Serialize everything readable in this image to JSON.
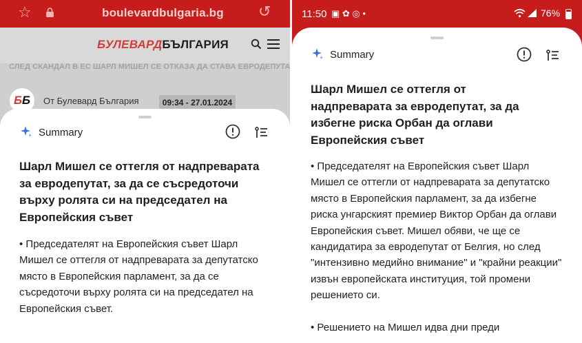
{
  "left": {
    "browser": {
      "url": "boulevardbulgaria.bg",
      "icons": [
        "star-icon",
        "lock-icon",
        "reload-icon"
      ]
    },
    "site": {
      "logo_part1": "БУЛЕВАРД",
      "logo_part2": "БЪЛГАРИЯ",
      "icons": [
        "search-icon",
        "menu-icon"
      ]
    },
    "article": {
      "headline": "СЛЕД СКАНДАЛ В ЕС ШАРЛ МИШЕЛ СЕ ОТКАЗА ДА СТАВА ЕВРОДЕПУТАТ",
      "badge_part1": "Б",
      "badge_part2": "Б",
      "author": "От Булевард България",
      "datetime": "09:34 - 27.01.2024"
    },
    "summary": {
      "title": "Summary",
      "heading": "Шарл Мишел се оттегля от надпреварата за евродепутат, за да се съсредоточи върху ролята си на председател на Европейския съвет",
      "body": "• Председателят на Европейския съвет Шарл Мишел се оттегля от надпреварата за депутатско място в Европейския парламент, за да се съсредоточи върху ролята си на председател на Европейския съвет.",
      "icons": [
        "sparkle-icon",
        "info-icon",
        "list-icon"
      ]
    }
  },
  "right": {
    "status": {
      "time": "11:50",
      "icons_text": "▣ ✿ ◎ •",
      "battery": "76%"
    },
    "summary": {
      "title": "Summary",
      "heading": "Шарл Мишел се оттегля от надпреварата за евродепутат, за да избегне риска Орбан да оглави Европейския съвет",
      "body": "• Председателят на Европейския съвет Шарл Мишел се оттегли от надпреварата за депутатско място в Европейския парламент, за да избегне риска унгарският премиер Виктор Орбан да оглави Европейския съвет. Мишел обяви, че ще се кандидатира за евродепутат от Белгия, но след \"интензивно медийно внимание\" и \"крайни реакции\" извън европейската институция, той промени решението си.",
      "body_cut": "• Решението на Мишел идва дни преди",
      "icons": [
        "sparkle-icon",
        "info-icon",
        "list-icon"
      ]
    }
  },
  "colors": {
    "brand_red": "#c71c1c",
    "sparkle_blue": "#3b6fe0"
  }
}
